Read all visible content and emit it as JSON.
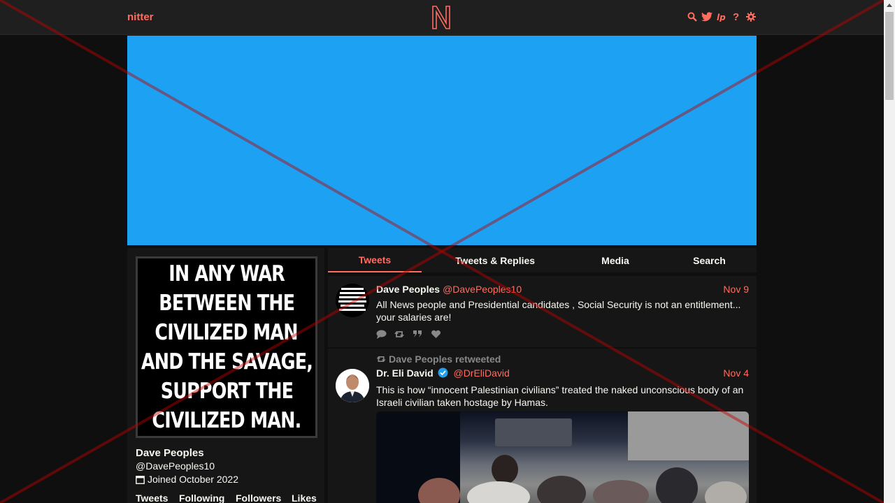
{
  "nav": {
    "brand": "nitter",
    "icons": [
      "search-icon",
      "twitter-bird-icon",
      "rss-icon",
      "help-icon",
      "gear-icon"
    ]
  },
  "profile": {
    "avatar_text": [
      "IN ANY WAR",
      "BETWEEN THE",
      "CIVILIZED MAN",
      "AND THE SAVAGE,",
      "SUPPORT THE",
      "CIVILIZED MAN."
    ],
    "name": "Dave Peoples",
    "handle": "@DavePeoples10",
    "joined": "Joined October 2022",
    "stats": {
      "tweets": "Tweets",
      "following": "Following",
      "followers": "Followers",
      "likes": "Likes"
    }
  },
  "tabs": [
    {
      "label": "Tweets",
      "active": true
    },
    {
      "label": "Tweets & Replies",
      "active": false
    },
    {
      "label": "Media",
      "active": false
    },
    {
      "label": "Search",
      "active": false
    }
  ],
  "tweets": [
    {
      "name": "Dave Peoples",
      "username": "@DavePeoples10",
      "date": "Nov 9",
      "text": "All News people and Presidential candidates , Social Security is not an entitlement... your salaries are!"
    },
    {
      "retweeted_by": "Dave Peoples retweeted",
      "name": "Dr. Eli David",
      "username": "@DrEliDavid",
      "date": "Nov 4",
      "text": "This is how “innocent Palestinian civilians” treated the naked unconscious body of an Israeli civilian taken hostage by Hamas."
    }
  ],
  "colors": {
    "accent": "#ff6c60",
    "banner": "#1da1f2",
    "background": "#0f0f0f",
    "panel": "#161616"
  }
}
